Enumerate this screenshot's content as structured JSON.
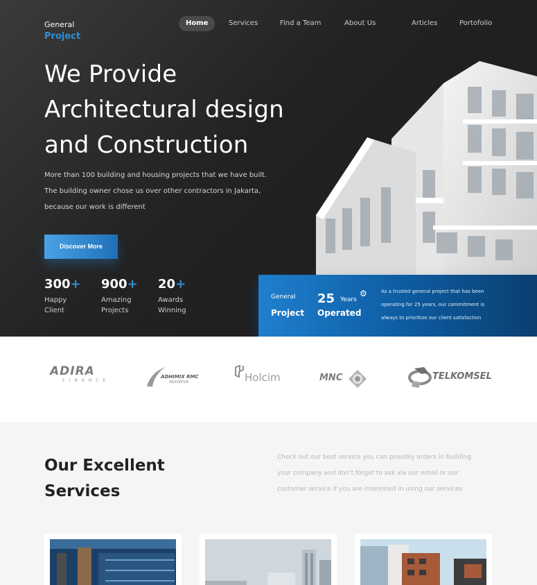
{
  "header": {
    "logo_line1": "General",
    "logo_line2": "Project",
    "nav": [
      "Home",
      "Services",
      "Find a Team",
      "About Us",
      "Articles",
      "Portofolio"
    ],
    "active_nav": "Home"
  },
  "hero": {
    "headline": [
      "We Provide",
      "Architectural design",
      "and Construction"
    ],
    "description": [
      "More than 100 building and housing projects that we have built.",
      "The building owner chose us over other contractors in Jakarta,",
      "because our work is different"
    ],
    "cta_label": "Discover More",
    "stats": [
      {
        "number": "300",
        "suffix": "+",
        "label_1": "Happy",
        "label_2": "Client"
      },
      {
        "number": "900",
        "suffix": "+",
        "label_1": "Amazing",
        "label_2": "Projects"
      },
      {
        "number": "20",
        "suffix": "+",
        "label_1": "Awards",
        "label_2": "Winning"
      }
    ]
  },
  "info_card": {
    "general": "General",
    "project": "Project",
    "years_number": "25",
    "years_label": "Years",
    "operated": "Operated",
    "description": [
      "As a trusted general project that has been",
      "operating for 25 years, our commitment is",
      "always to prioritize our client satisfaction"
    ]
  },
  "partners": {
    "adira": "ADIRA",
    "adira_sub": "FINANCE",
    "adhimix": "ADHIMIX RMC",
    "adhimix_sub": "INDONESIA",
    "holcim": "Holcim",
    "mnc": "MNC",
    "telkomsel": "TELKOMSEL"
  },
  "services": {
    "title": [
      "Our Excellent",
      "Services"
    ],
    "description": [
      "Check out our best service you can possibly orders in building",
      "your company and don't forget to ask via our email or our",
      "customer service if you are interested in using our services"
    ]
  },
  "colors": {
    "accent": "#2f8fd8",
    "hero_bg": "#262626",
    "card_blue": "#0d5a9e",
    "services_bg": "#f5f5f5"
  }
}
